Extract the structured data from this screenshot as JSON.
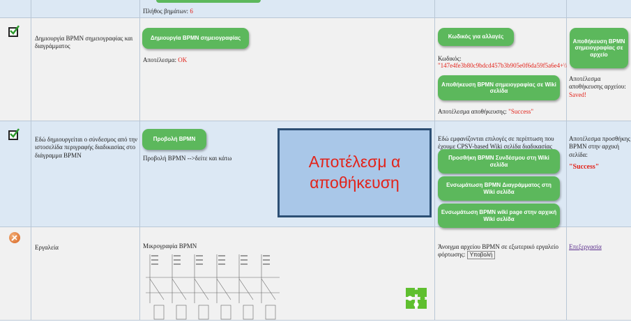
{
  "row0": {
    "steps_label": "Πλήθος βημάτων:",
    "steps_value": "6"
  },
  "row1": {
    "title": "Δημιουργία BPMN σημειογραφίας και διαγράμματος",
    "create_btn": "Δημιουργία BPMN σημειογραφίας",
    "result_label": "Αποτέλεσμα:",
    "result_value": "OK",
    "code_btn": "Κωδικός για αλλαγές",
    "code_label": "Κωδικός:",
    "code_value": "\"147e4fe3b80c9bdcd457b3b905e0f6da59f5a6e4+\\\\\"",
    "save_wiki_btn": "Αποθήκευση BPMN σημειογραφίας σε Wiki σελίδα",
    "save_result_label": "Αποτέλεσμα αποθήκευσης:",
    "save_result_value": "\"Success\"",
    "save_file_btn": "Αποθήκευση BPMN σημειογραφίας σε αρχείο",
    "file_result_label": "Αποτέλεσμα αποθήκευσης αρχείου:",
    "file_result_value": "Saved!"
  },
  "row2": {
    "title": "Εδώ δημιουργείται ο σύνδεσμος από την ιστοσελίδα περιγραφής διαδικασίας στο διάγραμμα BPMN",
    "view_btn": "Προβολή BPMN",
    "view_text": "Προβολή BPMN -->δείτε και κάτω",
    "callout": "Αποτέλεσμ α αποθήκευση",
    "options_text": "Εδώ εμφανίζονται επιλογές σε περίπτωση που έχουμε CPSV-based Wiki σελίδα διαδικασίας",
    "add_link_btn": "Προσθήκη BPMN Συνδέσμου στη Wiki σελίδα",
    "embed_diagram_btn": "Ενσωμάτωση BPMN Διαγράμματος στη Wiki σελίδα",
    "embed_page_btn": "Ενσωμάτωση BPMN wiki page στην αρχική Wiki σελίδα",
    "home_result_label": "Αποτέλεσμα προσθήκης BPMN στην αρχική σελίδα:",
    "home_result_value": "\"Success\""
  },
  "row3": {
    "title": "Εργαλεία",
    "micro_label": "Μικρογραφία BPMN",
    "external_text": "Άνοιγμα αρχείου BPMN σε εξωτερικό εργαλείο φόρτωσης:",
    "upload_btn": "Υποβολή",
    "edit_link": "Επεξεργασία"
  },
  "colors": {
    "green": "#5cb85c",
    "red": "#e2231a",
    "callout_bg": "#a9c7e8",
    "callout_border": "#2c4f74"
  }
}
